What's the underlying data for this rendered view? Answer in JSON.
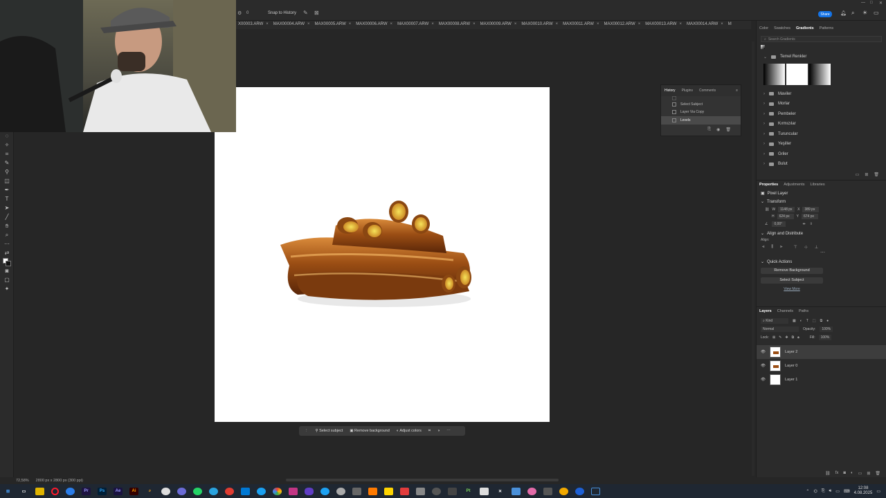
{
  "topbar": {
    "snap_label": "Snap to History",
    "zoom_value": "0",
    "share_button": "Share"
  },
  "tabs": [
    "X00003.ARW",
    "MAX00004.ARW",
    "MAX00005.ARW",
    "MAX00006.ARW",
    "MAX00007.ARW",
    "MAX00008.ARW",
    "MAX00009.ARW",
    "MAX00010.ARW",
    "MAX00011.ARW",
    "MAX00012.ARW",
    "MAX00013.ARW",
    "MAX00014.ARW",
    "M"
  ],
  "gradients_panel": {
    "tabs": [
      "Color",
      "Swatches",
      "Gradients",
      "Patterns"
    ],
    "active_tab": "Gradients",
    "search_placeholder": "Search Gradients",
    "group_open": "Temel Renkler",
    "folders": [
      "Maviler",
      "Morlar",
      "Pembeler",
      "Kırmızılar",
      "Turuncular",
      "Yeşiller",
      "Griler",
      "Bulut"
    ]
  },
  "history_panel": {
    "tabs": [
      "History",
      "Plugins",
      "Comments"
    ],
    "items": [
      "Select Subject",
      "Layer Via Copy",
      "Levels"
    ]
  },
  "properties_panel": {
    "tabs": [
      "Properties",
      "Adjustments",
      "Libraries"
    ],
    "kind": "Pixel Layer",
    "transform_title": "Transform",
    "w_label": "W",
    "w_value": "1148 px",
    "h_label": "H",
    "h_value": "624 px",
    "x_label": "X",
    "x_value": "389 px",
    "y_label": "Y",
    "y_value": "674 px",
    "angle_value": "0,00°",
    "align_title": "Align and Distribute",
    "align_sub": "Align:",
    "quick_actions_title": "Quick Actions",
    "remove_bg": "Remove Background",
    "select_subject": "Select Subject",
    "view_more": "View More"
  },
  "layers_panel": {
    "tabs": [
      "Layers",
      "Channels",
      "Paths"
    ],
    "kind_filter": "Kind",
    "blend_mode": "Normal",
    "opacity_label": "Opacity:",
    "opacity_value": "100%",
    "lock_label": "Lock:",
    "fill_label": "Fill:",
    "fill_value": "100%",
    "layers": [
      "Layer 2",
      "Layer 0",
      "Layer 1"
    ]
  },
  "context_bar": {
    "select_subject": "Select subject",
    "remove_background": "Remove background",
    "adjust_colors": "Adjust colors"
  },
  "status": {
    "zoom": "72,58%",
    "doc_size": "2800 px x 2800 px (300 ppi)"
  },
  "taskbar": {
    "time": "12:08",
    "date": "4.08.2025"
  },
  "colors": {
    "accent": "#1473e6",
    "app_bg": "#262626",
    "panel_bg": "#2b2b2b",
    "taskbar_bg": "#1f2732"
  },
  "taskbar_icons": [
    "start-icon",
    "search-icon",
    "files-icon",
    "opera-icon",
    "edge-icon",
    "premiere-icon",
    "photoshop-icon",
    "aftereffects-icon",
    "illustrator-icon",
    "search-app-icon",
    "app-icon",
    "app-icon",
    "whatsapp-icon",
    "telegram-icon",
    "app-icon",
    "store-icon",
    "app-icon",
    "chrome-icon",
    "app-icon",
    "vpn-icon",
    "app-icon",
    "steam-icon",
    "app-icon",
    "app-icon",
    "app-icon",
    "app-icon",
    "app-icon",
    "app-icon",
    "pt-icon",
    "capcut-icon",
    "app-icon",
    "app-icon",
    "app-icon",
    "app-icon",
    "app-icon",
    "app-icon"
  ]
}
